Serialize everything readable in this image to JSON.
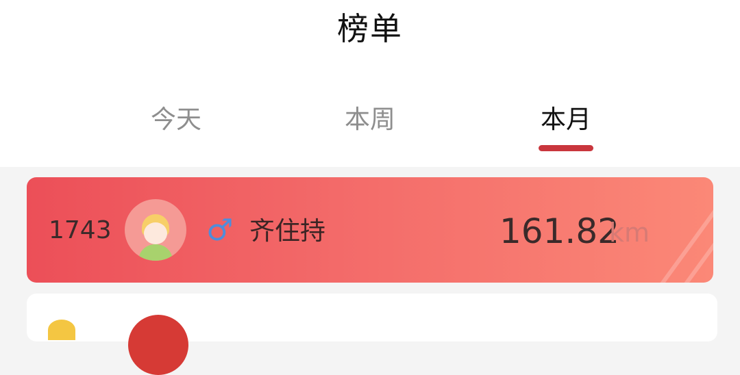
{
  "header": {
    "title": "榜单"
  },
  "tabs": [
    {
      "label": "今天",
      "active": false
    },
    {
      "label": "本周",
      "active": false
    },
    {
      "label": "本月",
      "active": true
    }
  ],
  "leaderboard": {
    "current_user": {
      "rank": "1743",
      "gender": "male",
      "name": "齐住持",
      "distance": "161.82",
      "unit": "km"
    }
  },
  "colors": {
    "accent": "#c9363d",
    "card_gradient_start": "#ec4f58",
    "card_gradient_end": "#fb8877",
    "male_icon": "#4f8ddb"
  }
}
